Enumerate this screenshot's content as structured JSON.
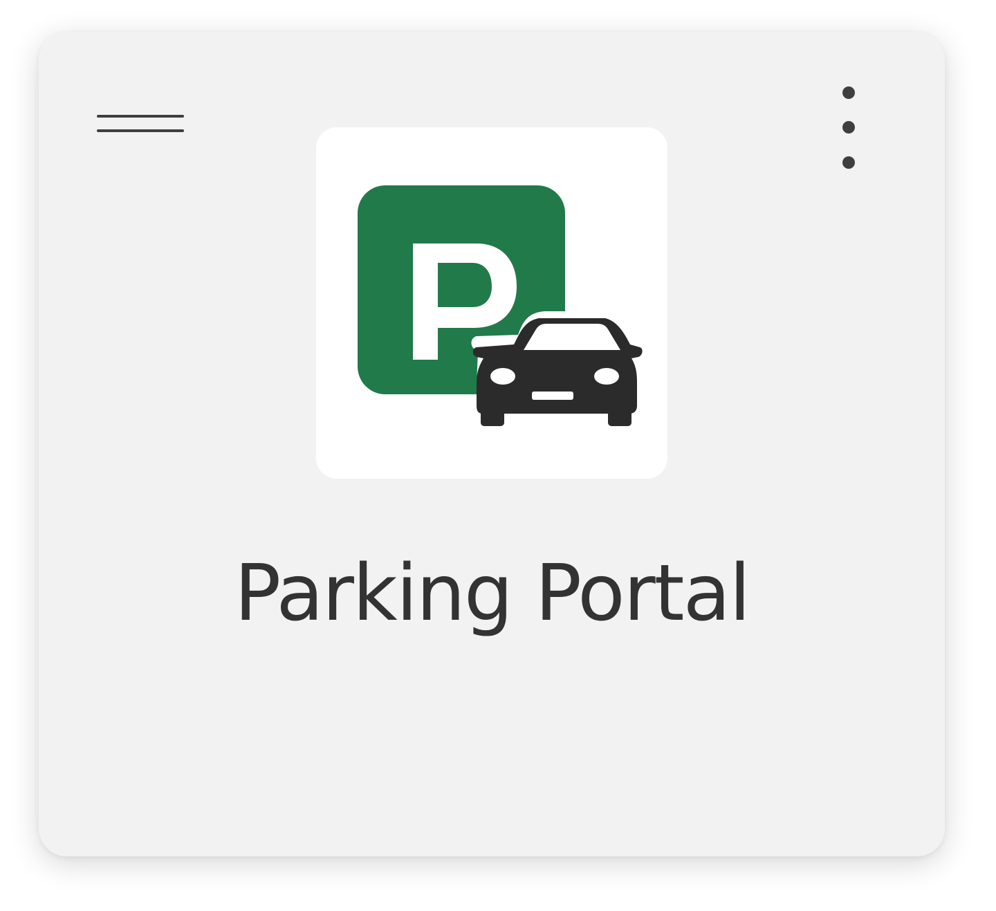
{
  "tile": {
    "app_name": "Parking Portal",
    "icon": "parking-portal-icon",
    "drag_handle_icon": "drag-handle-icon",
    "more_options_icon": "more-vertical-icon"
  },
  "colors": {
    "tile_background": "#f2f2f2",
    "icon_background": "#ffffff",
    "parking_sign_green": "#217a49",
    "car": "#2b2b2b",
    "text": "#333333",
    "controls": "#3f3f3f"
  }
}
